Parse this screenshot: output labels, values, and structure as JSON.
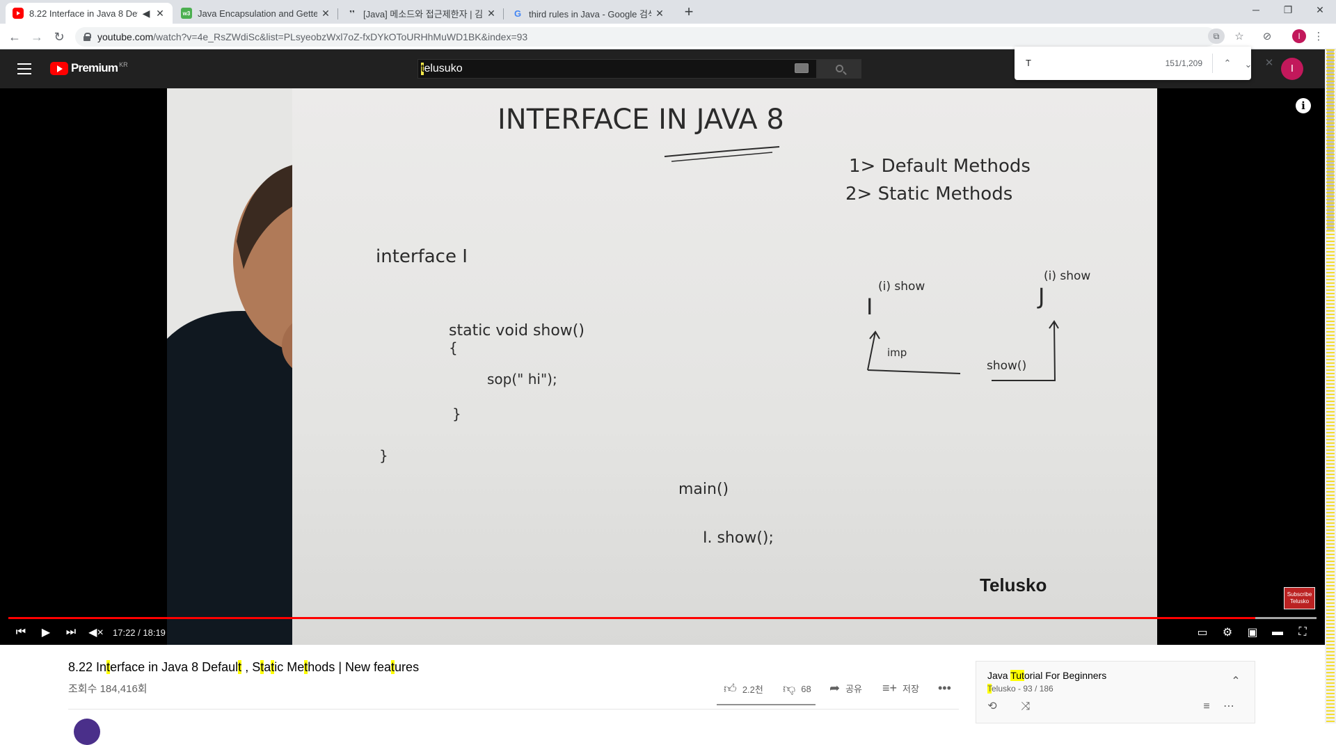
{
  "tabs": [
    {
      "title": "8.22 Interface in Java 8 Def",
      "favicon": "youtube-icon",
      "active": true
    },
    {
      "title": "Java Encapsulation and Getters",
      "favicon": "w3schools-icon",
      "active": false
    },
    {
      "title": "[Java] 메소드와 접근제한자 | 김",
      "favicon": "blog-icon",
      "active": false
    },
    {
      "title": "third rules in Java - Google 검색",
      "favicon": "google-icon",
      "active": false
    }
  ],
  "address": {
    "host": "youtube.com",
    "path": "/watch?v=4e_RsZWdiSc&list=PLsyeobzWxl7oZ-fxDYkOToURHhMuWD1BK&index=93"
  },
  "yt": {
    "logo_text": "Premium",
    "logo_region": "KR",
    "search_highlight": "t",
    "search_rest": "elusuko",
    "avatar_letter": "I"
  },
  "profile_letter": "I",
  "find": {
    "query": "T",
    "count": "151/1,209"
  },
  "video": {
    "watermark": "Telusko",
    "subscribe_badge": "Subscribe Telusko",
    "time": "17:22 / 18:19",
    "progress": 0.9534,
    "loaded": 1.0,
    "title_parts": [
      {
        "t": "8.22 In",
        "h": false
      },
      {
        "t": "t",
        "h": true
      },
      {
        "t": "erface in Java 8 Defaul",
        "h": false
      },
      {
        "t": "t",
        "h": true
      },
      {
        "t": " , S",
        "h": false
      },
      {
        "t": "t",
        "h": true
      },
      {
        "t": "a",
        "h": false
      },
      {
        "t": "t",
        "h": true
      },
      {
        "t": "ic Me",
        "h": false
      },
      {
        "t": "t",
        "h": true
      },
      {
        "t": "hods | New fea",
        "h": false
      },
      {
        "t": "t",
        "h": true
      },
      {
        "t": "ures",
        "h": false
      }
    ],
    "views": "조회수 184,416회",
    "likes": "2.2천",
    "dislikes": "68",
    "share": "공유",
    "save": "저장"
  },
  "playlist": {
    "title_pre": "Java ",
    "title_hl": "Tut",
    "title_post": "orial For Beginners",
    "sub_hl": "T",
    "sub_rest": "elusko - 93 / 186"
  },
  "board_text": {
    "heading": "INTERFACE IN JAVA 8",
    "item1": "1> Default Methods",
    "item2": "2> Static Methods",
    "code1": "interface I",
    "code2": "static void show()",
    "code3": "{",
    "code4": "sop(\" hi\");",
    "code5": "}",
    "code6": "}",
    "diag_i": "I",
    "diag_i_show": "(i) show",
    "diag_j": "J",
    "diag_j_show": "(i) show",
    "diag_imp": "imp",
    "diag_show": "show()",
    "main": "main()",
    "call": "I. show();"
  }
}
